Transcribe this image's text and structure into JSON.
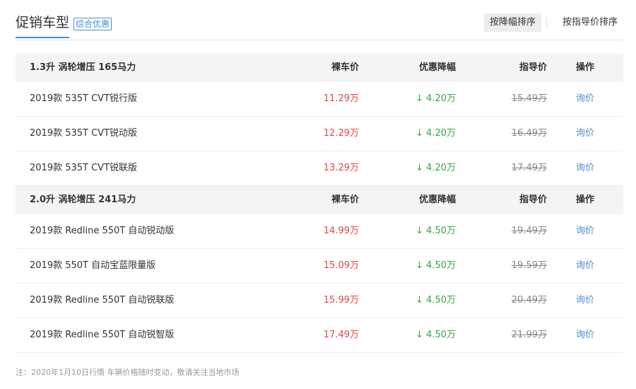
{
  "header": {
    "title": "促销车型",
    "badge": "综合优惠",
    "sort_active": "按降幅排序",
    "sort_other": "按指导价排序"
  },
  "columns": {
    "price": "裸车价",
    "discount": "优惠降幅",
    "guide": "指导价",
    "operation": "操作"
  },
  "groups": [
    {
      "name": "1.3升 涡轮增压 165马力",
      "rows": [
        {
          "name": "2019款 535T CVT锐行版",
          "price": "11.29万",
          "discount": "4.20万",
          "guide": "15.49万",
          "action": "询价"
        },
        {
          "name": "2019款 535T CVT锐动版",
          "price": "12.29万",
          "discount": "4.20万",
          "guide": "16.49万",
          "action": "询价"
        },
        {
          "name": "2019款 535T CVT锐联版",
          "price": "13.29万",
          "discount": "4.20万",
          "guide": "17.49万",
          "action": "询价"
        }
      ]
    },
    {
      "name": "2.0升 涡轮增压 241马力",
      "rows": [
        {
          "name": "2019款 Redline 550T 自动锐动版",
          "price": "14.99万",
          "discount": "4.50万",
          "guide": "19.49万",
          "action": "询价"
        },
        {
          "name": "2019款 550T 自动宝蓝限量版",
          "price": "15.09万",
          "discount": "4.50万",
          "guide": "19.59万",
          "action": "询价"
        },
        {
          "name": "2019款 Redline 550T 自动锐联版",
          "price": "15.99万",
          "discount": "4.50万",
          "guide": "20.49万",
          "action": "询价"
        },
        {
          "name": "2019款 Redline 550T 自动锐智版",
          "price": "17.49万",
          "discount": "4.50万",
          "guide": "21.99万",
          "action": "询价"
        }
      ]
    }
  ],
  "icons": {
    "discount_arrow": "down-arrow-icon",
    "arrow_glyph": "↓"
  },
  "colors": {
    "accent": "#4a8fcf",
    "price": "#e64545",
    "discount": "#3aa34a",
    "guide": "#888888"
  },
  "footer": {
    "note": "注：2020年1月10日行情 车辆价格随时变动，敬请关注当地市场"
  }
}
